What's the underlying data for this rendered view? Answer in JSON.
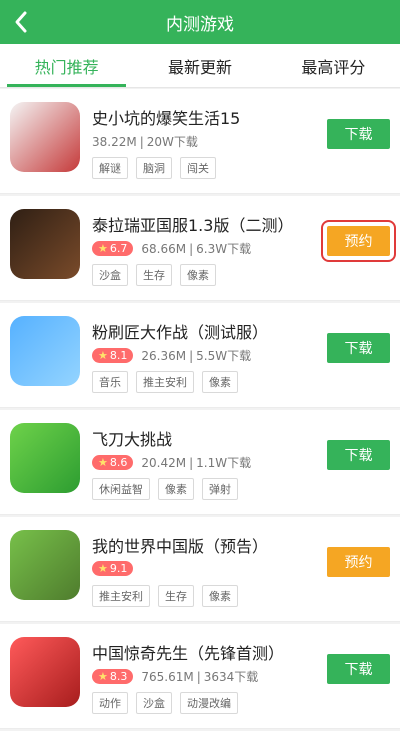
{
  "header": {
    "title": "内测游戏"
  },
  "tabs": [
    "热门推荐",
    "最新更新",
    "最高评分"
  ],
  "games": [
    {
      "name": "史小坑的爆笑生活15",
      "rating": "",
      "size": "38.22M",
      "downloads": "20W下载",
      "tags": [
        "解谜",
        "脑洞",
        "闯关"
      ],
      "button": "下载",
      "button_type": "download",
      "highlight": false,
      "icon": "cartoon-face-icon"
    },
    {
      "name": "泰拉瑞亚国服1.3版（二测）",
      "rating": "6.7",
      "size": "68.66M",
      "downloads": "6.3W下载",
      "tags": [
        "沙盒",
        "生存",
        "像素"
      ],
      "button": "预约",
      "button_type": "reserve",
      "highlight": true,
      "icon": "pixel-adventure-icon"
    },
    {
      "name": "粉刷匠大作战（测试服）",
      "rating": "8.1",
      "size": "26.36M",
      "downloads": "5.5W下载",
      "tags": [
        "音乐",
        "推主安利",
        "像素"
      ],
      "button": "下载",
      "button_type": "download",
      "highlight": false,
      "icon": "brush-character-icon"
    },
    {
      "name": "飞刀大挑战",
      "rating": "8.6",
      "size": "20.42M",
      "downloads": "1.1W下载",
      "tags": [
        "休闲益智",
        "像素",
        "弹射"
      ],
      "button": "下载",
      "button_type": "download",
      "highlight": false,
      "icon": "knife-icon"
    },
    {
      "name": "我的世界中国版（预告）",
      "rating": "9.1",
      "size": "",
      "downloads": "",
      "tags": [
        "推主安利",
        "生存",
        "像素"
      ],
      "button": "预约",
      "button_type": "reserve",
      "highlight": false,
      "icon": "minecraft-block-icon"
    },
    {
      "name": "中国惊奇先生（先锋首测）",
      "rating": "8.3",
      "size": "765.61M",
      "downloads": "3634下载",
      "tags": [
        "动作",
        "沙盒",
        "动漫改编"
      ],
      "button": "下载",
      "button_type": "download",
      "highlight": false,
      "icon": "anime-character-icon"
    }
  ]
}
